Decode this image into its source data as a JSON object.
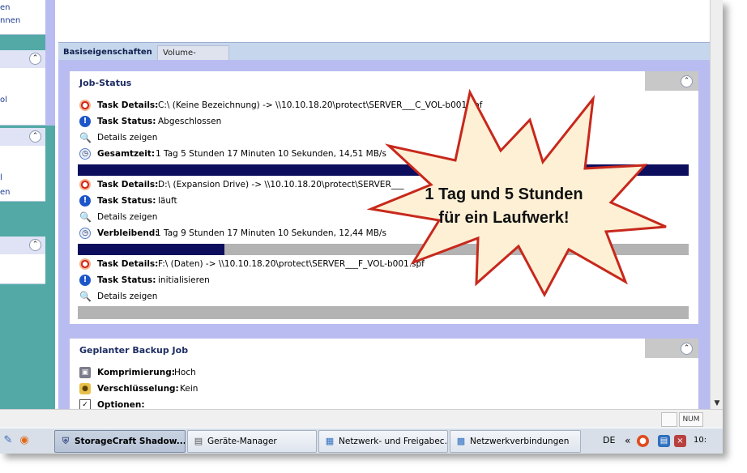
{
  "sidebar": {
    "panel1_lines": [
      "en",
      "nnen"
    ],
    "panel2_lines": [
      "ol"
    ],
    "panel3_lines": [
      "l",
      "en"
    ]
  },
  "tabs": {
    "active": "Basiseigenschaften",
    "inactive": "Volume-Backup - Abgeschlossen"
  },
  "job_status": {
    "title": "Job-Status",
    "tasks": [
      {
        "details_label": "Task Details:",
        "details_value": "C:\\ (Keine Bezeichnung) -> \\\\10.10.18.20\\protect\\SERVER___C_VOL-b001.spf",
        "status_label": "Task Status:",
        "status_value": "Abgeschlossen",
        "show_details": "Details zeigen",
        "time_label": "Gesamtzeit:",
        "time_value": "1 Tag 5 Stunden 17 Minuten 10 Sekunden, 14,51 MB/s",
        "progress": 1.0
      },
      {
        "details_label": "Task Details:",
        "details_value": "D:\\ (Expansion Drive) -> \\\\10.10.18.20\\protect\\SERVER___",
        "status_label": "Task Status:",
        "status_value": "läuft",
        "show_details": "Details zeigen",
        "time_label": "Verbleibend:",
        "time_value": "1 Tag 9 Stunden 17 Minuten 10 Sekunden, 12,44 MB/s",
        "progress": 0.24
      },
      {
        "details_label": "Task Details:",
        "details_value": "F:\\ (Daten) -> \\\\10.10.18.20\\protect\\SERVER___F_VOL-b001.spf",
        "status_label": "Task Status:",
        "status_value": "initialisieren",
        "show_details": "Details zeigen",
        "progress": 0.0
      }
    ]
  },
  "scheduled": {
    "title": "Geplanter Backup Job",
    "compression_label": "Komprimierung:",
    "compression_value": "Hoch",
    "encryption_label": "Verschlüsselung:",
    "encryption_value": "Kein",
    "options_label": "Optionen:"
  },
  "statusbar": {
    "num": "NUM"
  },
  "taskbar": {
    "buttons": [
      "StorageCraft Shadow...",
      "Geräte-Manager",
      "Netzwerk- und Freigabec...",
      "Netzwerkverbindungen"
    ],
    "language": "DE",
    "tray_arrow": "«",
    "clock": "10:"
  },
  "callout": {
    "line1": "1 Tag und 5 Stunden",
    "line2": "für ein Laufwerk!"
  },
  "colors": {
    "accent_band": "#b9bcf0",
    "progress_fill": "#0d0d5e",
    "sidebar_teal": "#53a9a6",
    "callout_fill": "#fdf0d5",
    "callout_stroke": "#c8281c"
  }
}
